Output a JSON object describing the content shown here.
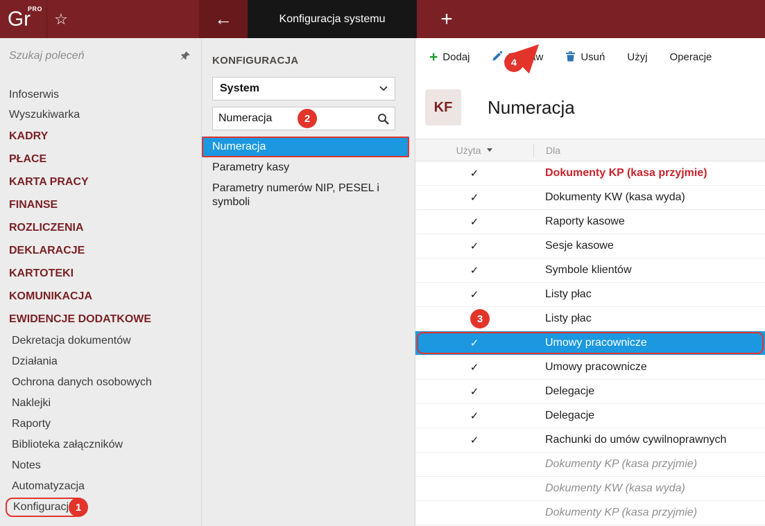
{
  "topbar": {
    "logo": "Gr",
    "logo_badge": "PRO",
    "tab_title": "Konfiguracja systemu"
  },
  "icons": {
    "star": "☆",
    "back_arrow": "←",
    "new_tab_plus": "+",
    "plus": "+",
    "check": "✓"
  },
  "annotations": {
    "step1": "1",
    "step2": "2",
    "step3": "3",
    "step4": "4"
  },
  "colors": {
    "brand": "#7B2125",
    "selection_blue": "#1B98E0",
    "annotation_red": "#E3342C",
    "highlight_row_red": "#C8232C"
  },
  "sidebar": {
    "search_placeholder": "Szukaj poleceń",
    "items": [
      {
        "label": "Infoserwis",
        "type": "normal"
      },
      {
        "label": "Wyszukiwarka",
        "type": "normal"
      },
      {
        "label": "KADRY",
        "type": "category"
      },
      {
        "label": "PŁACE",
        "type": "category"
      },
      {
        "label": "KARTA PRACY",
        "type": "category"
      },
      {
        "label": "FINANSE",
        "type": "category"
      },
      {
        "label": "ROZLICZENIA",
        "type": "category"
      },
      {
        "label": "DEKLARACJE",
        "type": "category"
      },
      {
        "label": "KARTOTEKI",
        "type": "category"
      },
      {
        "label": "KOMUNIKACJA",
        "type": "category"
      },
      {
        "label": "EWIDENCJE DODATKOWE",
        "type": "category"
      },
      {
        "label": "Dekretacja dokumentów",
        "type": "sub"
      },
      {
        "label": "Działania",
        "type": "sub"
      },
      {
        "label": "Ochrona danych osobowych",
        "type": "sub"
      },
      {
        "label": "Naklejki",
        "type": "sub"
      },
      {
        "label": "Raporty",
        "type": "sub"
      },
      {
        "label": "Biblioteka załączników",
        "type": "sub"
      },
      {
        "label": "Notes",
        "type": "sub"
      },
      {
        "label": "Automatyzacja",
        "type": "sub"
      },
      {
        "label": "Konfiguracja",
        "type": "sub",
        "annotated": true
      }
    ]
  },
  "panel": {
    "title": "KONFIGURACJA",
    "dropdown_value": "System",
    "search_value": "Numeracja",
    "selected_index": 0,
    "items": [
      "Numeracja",
      "Parametry kasy",
      "Parametry numerów NIP, PESEL i symboli"
    ]
  },
  "content": {
    "toolbar": [
      {
        "label": "Dodaj",
        "icon": "plus-icon"
      },
      {
        "label": "Popraw",
        "icon": "pencil-icon"
      },
      {
        "label": "Usuń",
        "icon": "trash-icon"
      },
      {
        "label": "Użyj"
      },
      {
        "label": "Operacje"
      }
    ],
    "badge": "KF",
    "title": "Numeracja",
    "table": {
      "columns": [
        "Użyta",
        "Dla"
      ],
      "rows": [
        {
          "used": true,
          "label": "Dokumenty KP (kasa przyjmie)",
          "style": "red-bold"
        },
        {
          "used": true,
          "label": "Dokumenty KW (kasa wyda)"
        },
        {
          "used": true,
          "label": "Raporty kasowe"
        },
        {
          "used": true,
          "label": "Sesje kasowe"
        },
        {
          "used": true,
          "label": "Symbole klientów"
        },
        {
          "used": true,
          "label": "Listy płac"
        },
        {
          "used": true,
          "label": "Listy płac",
          "badge": "3"
        },
        {
          "used": true,
          "label": "Umowy pracownicze",
          "selected": true,
          "outlined": true
        },
        {
          "used": true,
          "label": "Umowy pracownicze"
        },
        {
          "used": true,
          "label": "Delegacje"
        },
        {
          "used": true,
          "label": "Delegacje"
        },
        {
          "used": true,
          "label": "Rachunki do umów cywilnoprawnych"
        },
        {
          "used": false,
          "label": "Dokumenty KP (kasa przyjmie)",
          "style": "italic"
        },
        {
          "used": false,
          "label": "Dokumenty KW (kasa wyda)",
          "style": "italic"
        },
        {
          "used": false,
          "label": "Dokumenty KP (kasa przyjmie)",
          "style": "italic"
        }
      ]
    }
  }
}
